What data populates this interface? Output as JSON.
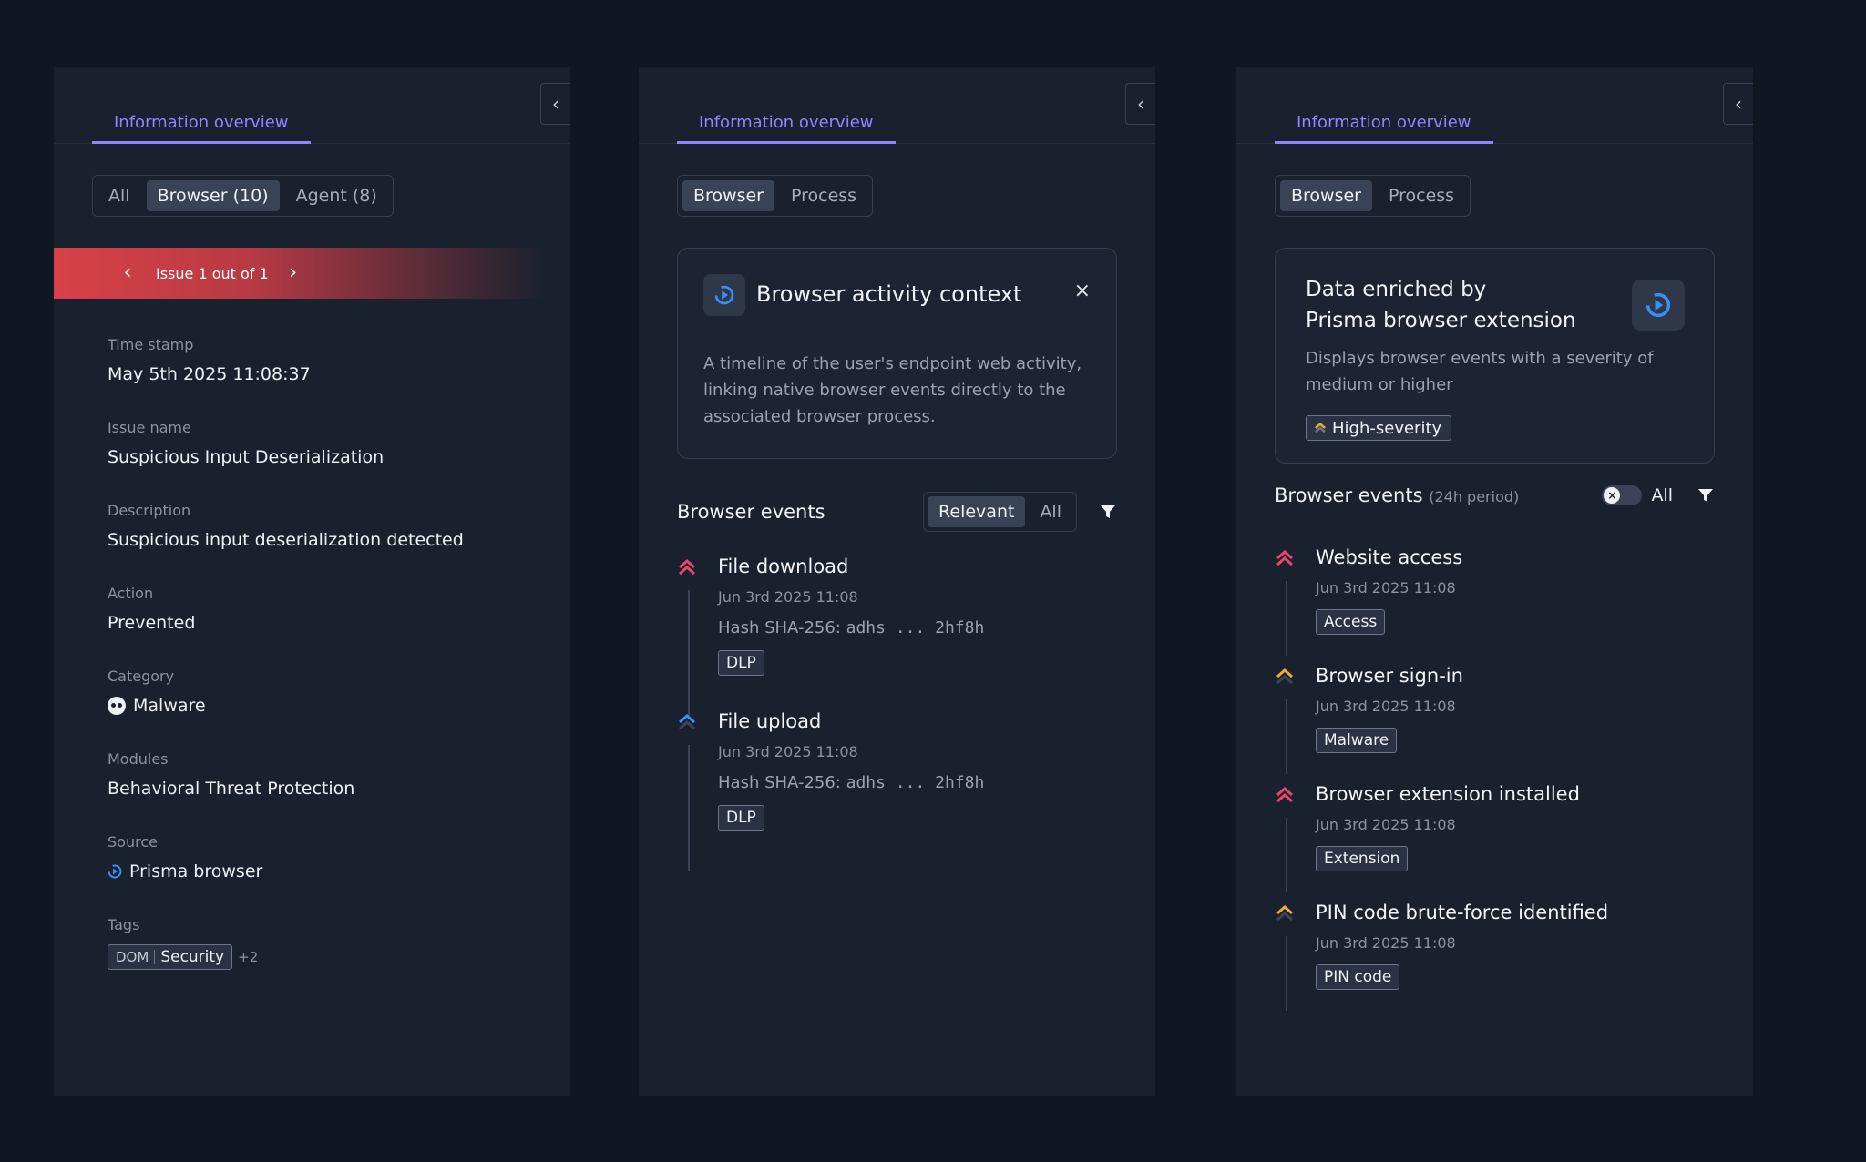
{
  "colors": {
    "background": "#111722",
    "panel": "#19212f",
    "accent_tab": "#8d86ff",
    "issue_banner": "#d84147",
    "severity_high": "#e8476a",
    "severity_medium": "#f0a63a",
    "severity_low": "#3a8ef6"
  },
  "panels": [
    {
      "tab": "Information overview",
      "collapse_icon": "chevron-left-icon",
      "segments": [
        "All",
        "Browser (10)",
        "Agent (8)"
      ],
      "active_segment": "Browser (10)",
      "issue_nav": "Issue 1 out of 1",
      "fields": [
        {
          "label": "Time stamp",
          "value": "May 5th 2025 11:08:37"
        },
        {
          "label": "Issue name",
          "value": "Suspicious Input Deserialization"
        },
        {
          "label": "Description",
          "value": "Suspicious input deserialization detected"
        },
        {
          "label": "Action",
          "value": "Prevented"
        },
        {
          "label": "Category",
          "value": "Malware",
          "icon": "skull-icon"
        },
        {
          "label": "Modules",
          "value": "Behavioral Threat Protection"
        },
        {
          "label": "Source",
          "value": "Prisma browser",
          "icon": "prisma-browser-icon"
        },
        {
          "label": "Tags",
          "tag_key": "DOM",
          "tag_value": "Security",
          "more": "+2"
        }
      ]
    },
    {
      "tab": "Information overview",
      "collapse_icon": "chevron-left-icon",
      "segments": [
        "Browser",
        "Process"
      ],
      "active_segment": "Browser",
      "context_card": {
        "title": "Browser activity context",
        "close": "×",
        "description": "A timeline of the user's endpoint web activity, linking native browser events directly to the associated browser process."
      },
      "events_title": "Browser events",
      "events_filter": [
        "Relevant",
        "All"
      ],
      "events_filter_active": "Relevant",
      "events": [
        {
          "name": "File download",
          "time": "Jun 3rd 2025 11:08",
          "hash_label": "Hash SHA-256:",
          "hash": "adhs ... 2hf8h",
          "tag": "DLP",
          "severity": "high"
        },
        {
          "name": "File upload",
          "time": "Jun 3rd 2025 11:08",
          "hash_label": "Hash SHA-256:",
          "hash": "adhs ... 2hf8h",
          "tag": "DLP",
          "severity": "low"
        }
      ]
    },
    {
      "tab": "Information overview",
      "collapse_icon": "chevron-left-icon",
      "segments": [
        "Browser",
        "Process"
      ],
      "active_segment": "Browser",
      "enrich_card": {
        "title_line1": "Data enriched by",
        "title_line2": "Prisma browser extension",
        "description": "Displays browser events with a severity of medium or higher",
        "severity_chip": "High-severity"
      },
      "events_title": "Browser events",
      "events_period": "(24h period)",
      "toggle_label": "All",
      "events": [
        {
          "name": "Website access",
          "time": "Jun 3rd 2025 11:08",
          "tag": "Access",
          "severity": "high"
        },
        {
          "name": "Browser sign-in",
          "time": "Jun 3rd 2025 11:08",
          "tag": "Malware",
          "severity": "medium"
        },
        {
          "name": "Browser extension installed",
          "time": "Jun 3rd 2025 11:08",
          "tag": "Extension",
          "severity": "high"
        },
        {
          "name": "PIN code brute-force identified",
          "time": "Jun 3rd 2025 11:08",
          "tag": "PIN code",
          "severity": "medium"
        }
      ]
    }
  ]
}
